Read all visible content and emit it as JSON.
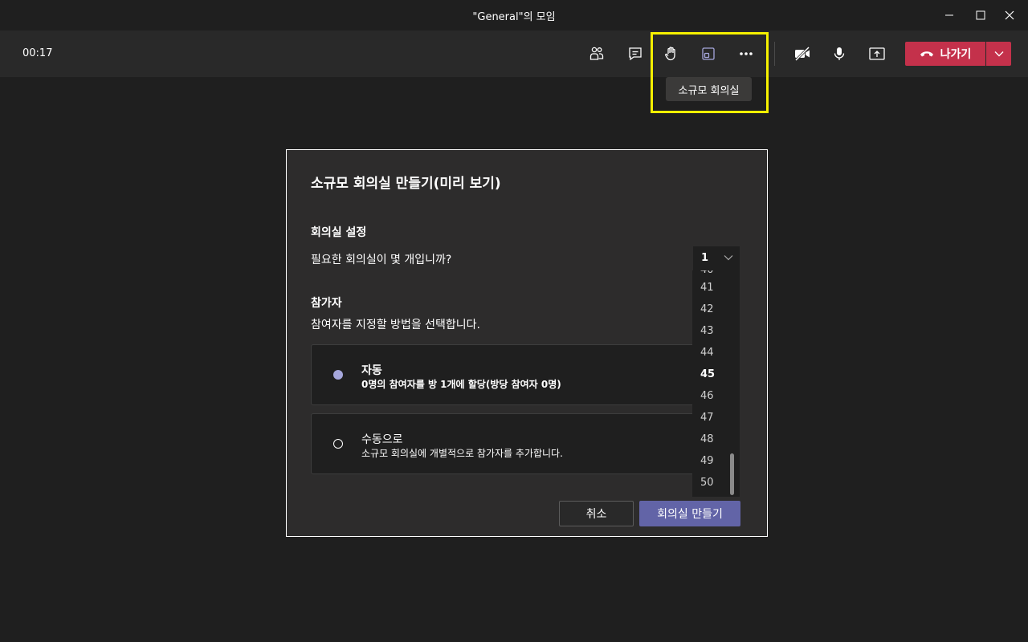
{
  "window": {
    "title": "\"General\"의 모임"
  },
  "toolbar": {
    "timer": "00:17",
    "tooltip": "소규모 회의실",
    "leave_label": "나가기",
    "leave_color": "#c4314b"
  },
  "dialog": {
    "title": "소규모 회의실 만들기(미리 보기)",
    "room_settings_heading": "회의실 설정",
    "rooms_question": "필요한 회의실이 몇 개입니까?",
    "rooms_selected": "1",
    "participants_heading": "참가자",
    "participants_text": "참여자를 지정할 방법을 선택합니다.",
    "options": [
      {
        "title": "자동",
        "desc": "0명의 참여자를 방 1개에 할당(방당 참여자 0명)",
        "selected": true
      },
      {
        "title": "수동으로",
        "desc": "소규모 회의실에 개별적으로 참가자를 추가합니다.",
        "selected": false
      }
    ],
    "dropdown_items": [
      "41",
      "42",
      "43",
      "44",
      "45",
      "46",
      "47",
      "48",
      "49",
      "50"
    ],
    "dropdown_highlighted": "45",
    "cancel_label": "취소",
    "create_label": "회의실 만들기",
    "accent_color": "#6264a7"
  },
  "annotation": {
    "highlight_color": "#f5f000"
  }
}
